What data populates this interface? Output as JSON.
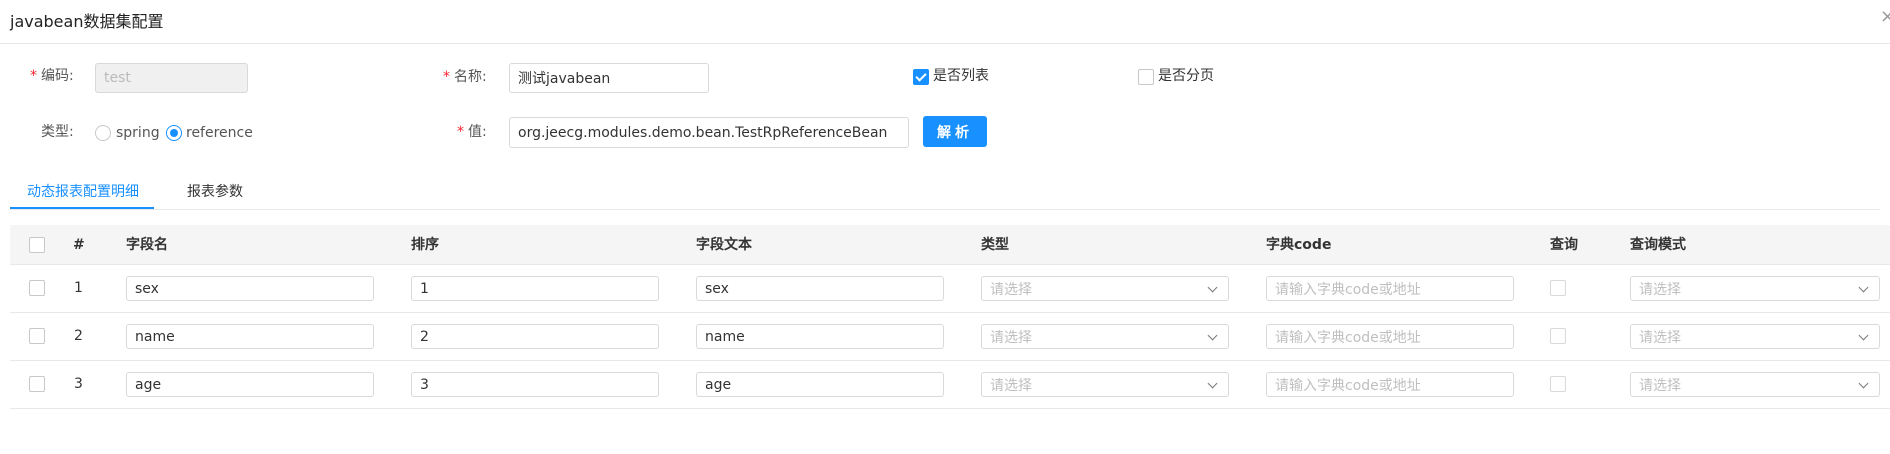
{
  "modal": {
    "title": "javabean数据集配置",
    "close_label": "×"
  },
  "form": {
    "code": {
      "label": "编码:",
      "required": true,
      "value": "test"
    },
    "name": {
      "label": "名称:",
      "required": true,
      "value": "测试javabean"
    },
    "is_list": {
      "label": "是否列表",
      "checked": true
    },
    "is_page": {
      "label": "是否分页",
      "checked": false
    },
    "type": {
      "label": "类型:",
      "options": [
        "spring",
        "reference"
      ],
      "selected": "reference"
    },
    "value": {
      "label": "值:",
      "required": true,
      "value": "org.jeecg.modules.demo.bean.TestRpReferenceBean"
    },
    "parse_button": "解析"
  },
  "tabs": [
    {
      "label": "动态报表配置明细",
      "active": true
    },
    {
      "label": "报表参数",
      "active": false
    }
  ],
  "table": {
    "columns": [
      "#",
      "字段名",
      "排序",
      "字段文本",
      "类型",
      "字典code",
      "查询",
      "查询模式"
    ],
    "select_placeholder": "请选择",
    "dict_placeholder": "请输入字典code或地址",
    "rows": [
      {
        "index": "1",
        "field_name": "sex",
        "order": "1",
        "field_text": "sex",
        "query": false
      },
      {
        "index": "2",
        "field_name": "name",
        "order": "2",
        "field_text": "name",
        "query": false
      },
      {
        "index": "3",
        "field_name": "age",
        "order": "3",
        "field_text": "age",
        "query": false
      }
    ]
  },
  "colors": {
    "primary": "#1890ff",
    "required": "#f5222d",
    "border": "#d9d9d9",
    "header_bg": "#f5f5f5"
  }
}
